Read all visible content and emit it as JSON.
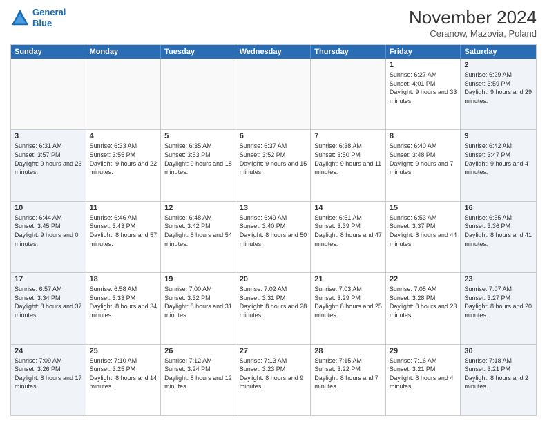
{
  "logo": {
    "line1": "General",
    "line2": "Blue"
  },
  "title": "November 2024",
  "subtitle": "Ceranow, Mazovia, Poland",
  "header_days": [
    "Sunday",
    "Monday",
    "Tuesday",
    "Wednesday",
    "Thursday",
    "Friday",
    "Saturday"
  ],
  "rows": [
    [
      {
        "day": "",
        "info": ""
      },
      {
        "day": "",
        "info": ""
      },
      {
        "day": "",
        "info": ""
      },
      {
        "day": "",
        "info": ""
      },
      {
        "day": "",
        "info": ""
      },
      {
        "day": "1",
        "info": "Sunrise: 6:27 AM\nSunset: 4:01 PM\nDaylight: 9 hours\nand 33 minutes."
      },
      {
        "day": "2",
        "info": "Sunrise: 6:29 AM\nSunset: 3:59 PM\nDaylight: 9 hours\nand 29 minutes."
      }
    ],
    [
      {
        "day": "3",
        "info": "Sunrise: 6:31 AM\nSunset: 3:57 PM\nDaylight: 9 hours\nand 26 minutes."
      },
      {
        "day": "4",
        "info": "Sunrise: 6:33 AM\nSunset: 3:55 PM\nDaylight: 9 hours\nand 22 minutes."
      },
      {
        "day": "5",
        "info": "Sunrise: 6:35 AM\nSunset: 3:53 PM\nDaylight: 9 hours\nand 18 minutes."
      },
      {
        "day": "6",
        "info": "Sunrise: 6:37 AM\nSunset: 3:52 PM\nDaylight: 9 hours\nand 15 minutes."
      },
      {
        "day": "7",
        "info": "Sunrise: 6:38 AM\nSunset: 3:50 PM\nDaylight: 9 hours\nand 11 minutes."
      },
      {
        "day": "8",
        "info": "Sunrise: 6:40 AM\nSunset: 3:48 PM\nDaylight: 9 hours\nand 7 minutes."
      },
      {
        "day": "9",
        "info": "Sunrise: 6:42 AM\nSunset: 3:47 PM\nDaylight: 9 hours\nand 4 minutes."
      }
    ],
    [
      {
        "day": "10",
        "info": "Sunrise: 6:44 AM\nSunset: 3:45 PM\nDaylight: 9 hours\nand 0 minutes."
      },
      {
        "day": "11",
        "info": "Sunrise: 6:46 AM\nSunset: 3:43 PM\nDaylight: 8 hours\nand 57 minutes."
      },
      {
        "day": "12",
        "info": "Sunrise: 6:48 AM\nSunset: 3:42 PM\nDaylight: 8 hours\nand 54 minutes."
      },
      {
        "day": "13",
        "info": "Sunrise: 6:49 AM\nSunset: 3:40 PM\nDaylight: 8 hours\nand 50 minutes."
      },
      {
        "day": "14",
        "info": "Sunrise: 6:51 AM\nSunset: 3:39 PM\nDaylight: 8 hours\nand 47 minutes."
      },
      {
        "day": "15",
        "info": "Sunrise: 6:53 AM\nSunset: 3:37 PM\nDaylight: 8 hours\nand 44 minutes."
      },
      {
        "day": "16",
        "info": "Sunrise: 6:55 AM\nSunset: 3:36 PM\nDaylight: 8 hours\nand 41 minutes."
      }
    ],
    [
      {
        "day": "17",
        "info": "Sunrise: 6:57 AM\nSunset: 3:34 PM\nDaylight: 8 hours\nand 37 minutes."
      },
      {
        "day": "18",
        "info": "Sunrise: 6:58 AM\nSunset: 3:33 PM\nDaylight: 8 hours\nand 34 minutes."
      },
      {
        "day": "19",
        "info": "Sunrise: 7:00 AM\nSunset: 3:32 PM\nDaylight: 8 hours\nand 31 minutes."
      },
      {
        "day": "20",
        "info": "Sunrise: 7:02 AM\nSunset: 3:31 PM\nDaylight: 8 hours\nand 28 minutes."
      },
      {
        "day": "21",
        "info": "Sunrise: 7:03 AM\nSunset: 3:29 PM\nDaylight: 8 hours\nand 25 minutes."
      },
      {
        "day": "22",
        "info": "Sunrise: 7:05 AM\nSunset: 3:28 PM\nDaylight: 8 hours\nand 23 minutes."
      },
      {
        "day": "23",
        "info": "Sunrise: 7:07 AM\nSunset: 3:27 PM\nDaylight: 8 hours\nand 20 minutes."
      }
    ],
    [
      {
        "day": "24",
        "info": "Sunrise: 7:09 AM\nSunset: 3:26 PM\nDaylight: 8 hours\nand 17 minutes."
      },
      {
        "day": "25",
        "info": "Sunrise: 7:10 AM\nSunset: 3:25 PM\nDaylight: 8 hours\nand 14 minutes."
      },
      {
        "day": "26",
        "info": "Sunrise: 7:12 AM\nSunset: 3:24 PM\nDaylight: 8 hours\nand 12 minutes."
      },
      {
        "day": "27",
        "info": "Sunrise: 7:13 AM\nSunset: 3:23 PM\nDaylight: 8 hours\nand 9 minutes."
      },
      {
        "day": "28",
        "info": "Sunrise: 7:15 AM\nSunset: 3:22 PM\nDaylight: 8 hours\nand 7 minutes."
      },
      {
        "day": "29",
        "info": "Sunrise: 7:16 AM\nSunset: 3:21 PM\nDaylight: 8 hours\nand 4 minutes."
      },
      {
        "day": "30",
        "info": "Sunrise: 7:18 AM\nSunset: 3:21 PM\nDaylight: 8 hours\nand 2 minutes."
      }
    ]
  ]
}
